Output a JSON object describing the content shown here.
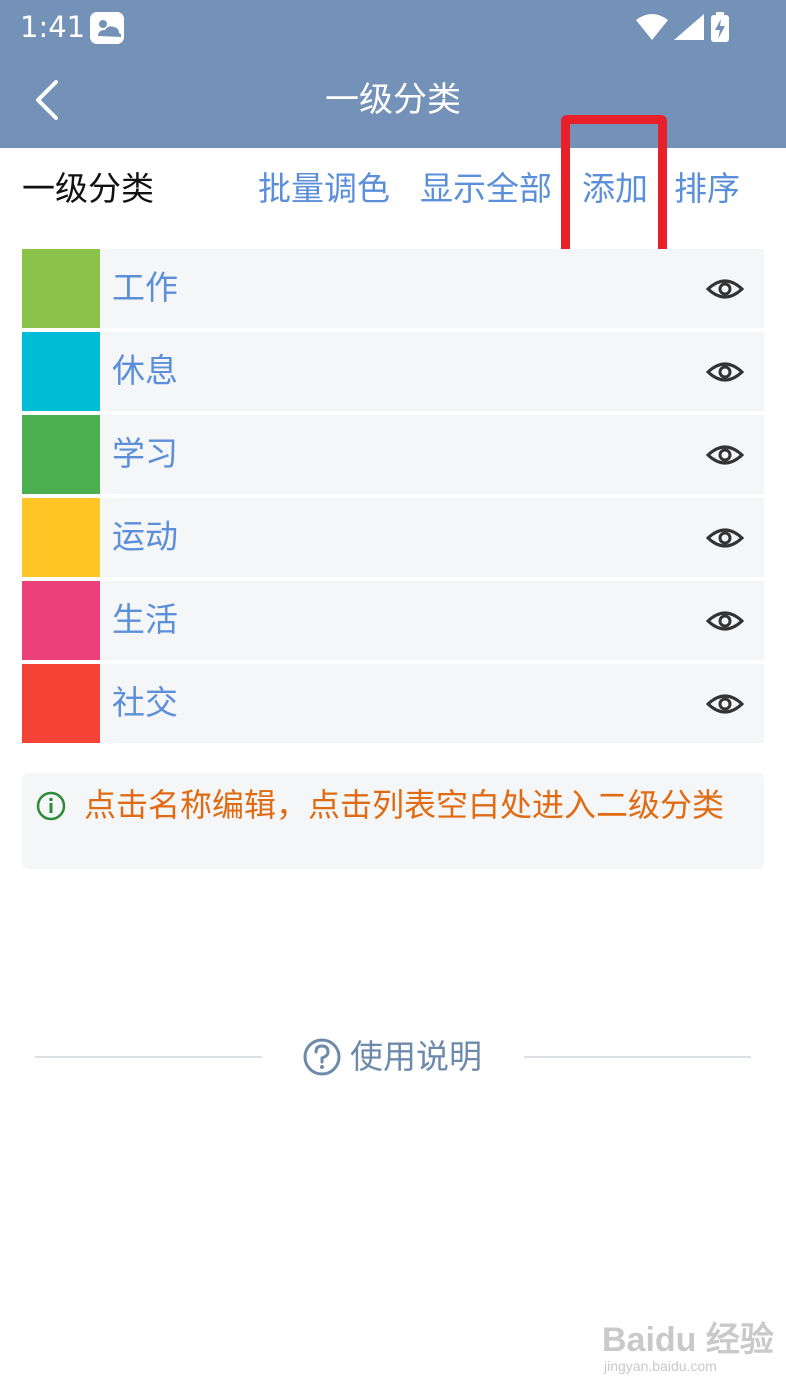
{
  "status_bar": {
    "time": "1:41",
    "icons": [
      "weather-icon",
      "wifi-icon",
      "signal-icon",
      "battery-charging-icon"
    ]
  },
  "nav": {
    "back_icon": "chevron-left-icon",
    "title": "一级分类"
  },
  "section": {
    "title": "一级分类",
    "actions": {
      "batch_color": "批量调色",
      "show_all": "显示全部",
      "add": "添加",
      "sort": "排序"
    }
  },
  "categories": [
    {
      "name": "工作",
      "color": "#8bc34a"
    },
    {
      "name": "休息",
      "color": "#00bcd4"
    },
    {
      "name": "学习",
      "color": "#4caf50"
    },
    {
      "name": "运动",
      "color": "#ffc626"
    },
    {
      "name": "生活",
      "color": "#ec407a"
    },
    {
      "name": "社交",
      "color": "#f44336"
    }
  ],
  "tip": {
    "icon": "info-icon",
    "text": "点击名称编辑，点击列表空白处进入二级分类"
  },
  "help": {
    "icon": "question-icon",
    "label": "使用说明"
  },
  "watermark": {
    "main": "Baidu 经验",
    "sub": "jingyan.baidu.com"
  },
  "colors": {
    "header": "#7492b8",
    "link": "#5b8fd9",
    "tip_text": "#e06b12",
    "highlight": "#e8202a"
  }
}
